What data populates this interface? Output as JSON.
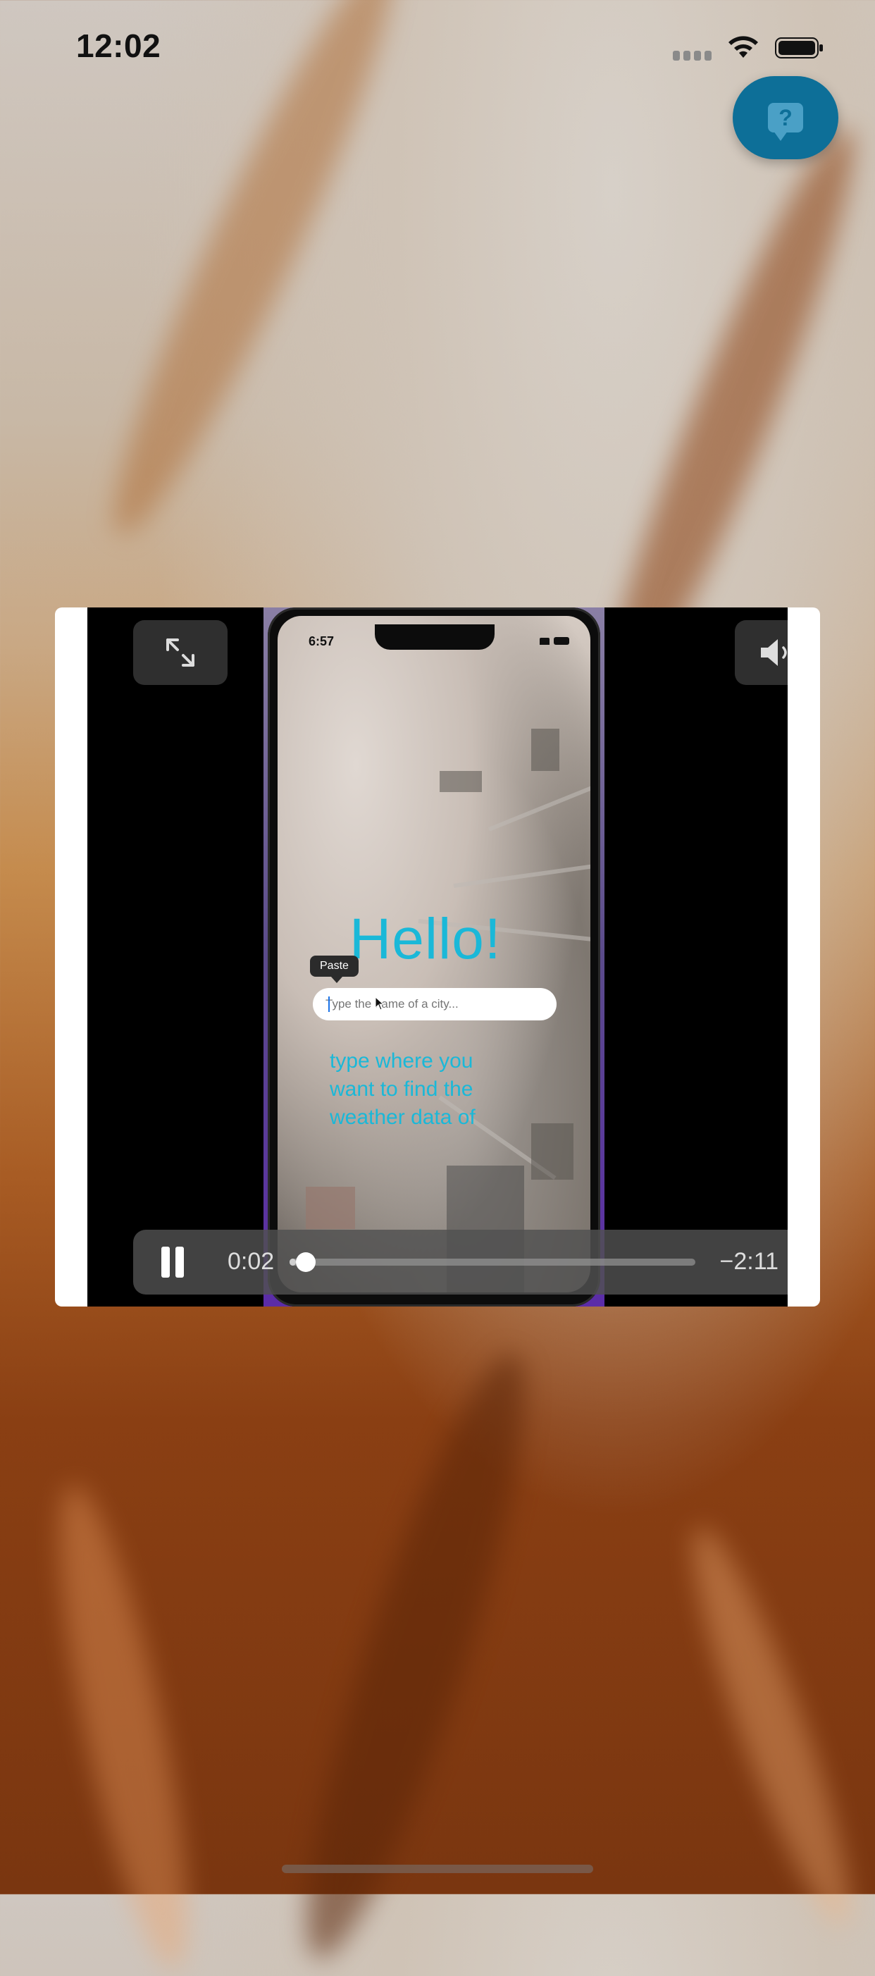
{
  "status_bar": {
    "time": "12:02",
    "icons": [
      "cellular-signal-icon",
      "wifi-icon",
      "battery-icon"
    ]
  },
  "help_button": {
    "icon": "help-chat-icon",
    "glyph": "?"
  },
  "video_player": {
    "controls": {
      "expand_icon": "expand-arrows-icon",
      "volume_icon": "speaker-volume-icon",
      "play_state_icon": "pause-icon",
      "elapsed": "0:02",
      "remaining": "−2:11",
      "progress": 0.015
    },
    "frame": {
      "phone_time": "6:57",
      "greeting": "Hello!",
      "paste_label": "Paste",
      "input_placeholder": "Type the name of a city...",
      "hint": "type where you want to find the weather data of"
    }
  },
  "colors": {
    "accent_teal": "#1ab8d8",
    "help_button": "#0d6f98"
  }
}
